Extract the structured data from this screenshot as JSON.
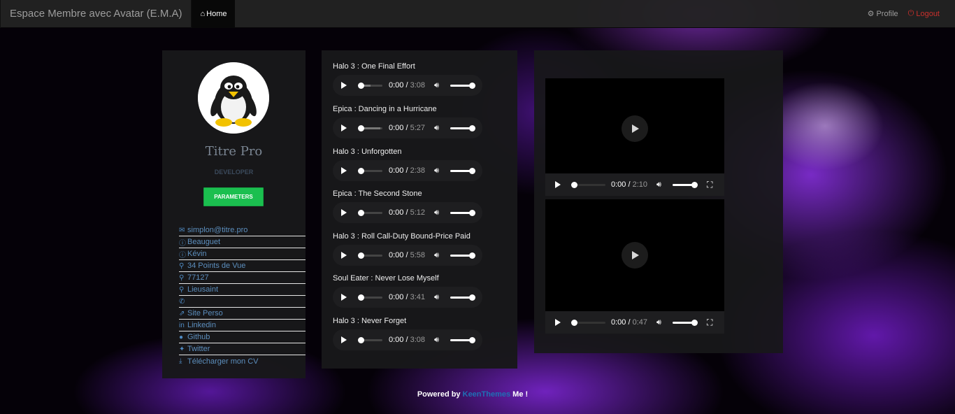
{
  "navbar": {
    "brand": "Espace Membre avec Avatar (E.M.A)",
    "home": "Home",
    "profile": "Profile",
    "logout": "Logout"
  },
  "profile": {
    "title": "Titre Pro",
    "role": "DEVELOPER",
    "button": "PARAMETERS",
    "info": [
      {
        "icon": "envelope-icon",
        "text": "simplon@titre.pro"
      },
      {
        "icon": "info-icon",
        "text": "Beauguet"
      },
      {
        "icon": "info-icon",
        "text": "Kévin"
      },
      {
        "icon": "map-marker-icon",
        "text": "34 Points de Vue"
      },
      {
        "icon": "map-marker-icon",
        "text": "77127"
      },
      {
        "icon": "map-marker-icon",
        "text": "Lieusaint"
      },
      {
        "icon": "phone-icon",
        "text": ""
      },
      {
        "icon": "external-link-icon",
        "text": "Site Perso"
      },
      {
        "icon": "linkedin-icon",
        "text": "Linkedin"
      },
      {
        "icon": "github-icon",
        "text": "Github"
      },
      {
        "icon": "twitter-icon",
        "text": "Twitter"
      },
      {
        "icon": "download-icon",
        "text": "Télécharger mon CV"
      }
    ]
  },
  "tracks": [
    {
      "title": "Halo 3 : One Final Effort",
      "current": "0:00",
      "duration": "3:08",
      "buffered": 0.5
    },
    {
      "title": "Epica : Dancing in a Hurricane",
      "current": "0:00",
      "duration": "5:27",
      "buffered": 0.9
    },
    {
      "title": "Halo 3 : Unforgotten",
      "current": "0:00",
      "duration": "2:38",
      "buffered": 0
    },
    {
      "title": "Epica : The Second Stone",
      "current": "0:00",
      "duration": "5:12",
      "buffered": 0
    },
    {
      "title": "Halo 3 : Roll Call-Duty Bound-Price Paid",
      "current": "0:00",
      "duration": "5:58",
      "buffered": 0
    },
    {
      "title": "Soul Eater : Never Lose Myself",
      "current": "0:00",
      "duration": "3:41",
      "buffered": 0
    },
    {
      "title": "Halo 3 : Never Forget",
      "current": "0:00",
      "duration": "3:08",
      "buffered": 0
    }
  ],
  "videos": [
    {
      "current": "0:00",
      "duration": "2:10"
    },
    {
      "current": "0:00",
      "duration": "0:47"
    }
  ],
  "footer": {
    "prefix": "Powered by",
    "brand": "KeenThemes",
    "suffix": "Me !"
  },
  "colors": {
    "accent_button": "#1bbf4f",
    "link": "#5c8ebd",
    "logout": "#c9302c"
  }
}
